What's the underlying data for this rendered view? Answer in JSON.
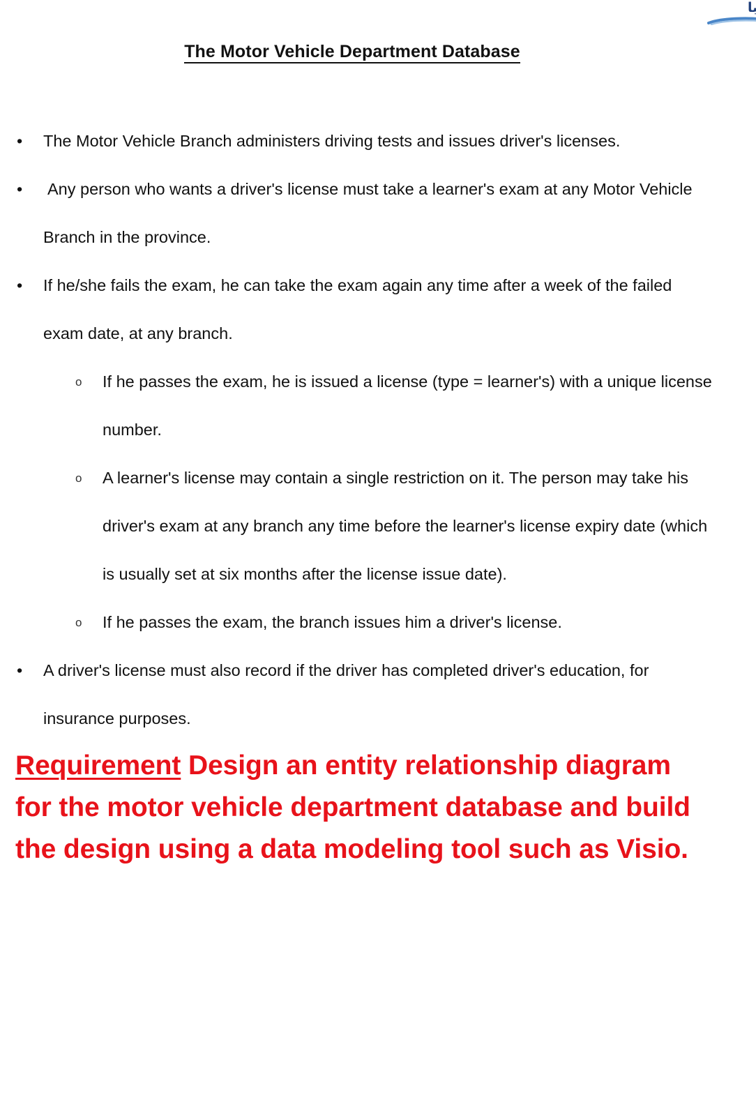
{
  "document": {
    "title": "The Motor Vehicle Department Database",
    "watermark": {
      "text": "يبا",
      "color": "#1f3f7a",
      "icon": "partial-arabic-logo"
    },
    "bullets": [
      {
        "marker": "•",
        "text": "The Motor Vehicle Branch administers driving tests and issues driver's licenses.",
        "children": []
      },
      {
        "marker": "•",
        "text": "Any person who wants a driver's license must take a learner's exam at any Motor Vehicle Branch in the province.",
        "children": []
      },
      {
        "marker": "•",
        "text": "If he/she fails the exam, he can take the exam again any time after a week of the failed exam date, at any branch.",
        "children": [
          {
            "marker": "o",
            "text": "If he passes the exam, he is issued a license (type = learner's) with a unique license number."
          },
          {
            "marker": "o",
            "text": "A learner's license may contain a single restriction on it. The person may take his driver's exam at any branch any time before the learner's license expiry date (which is usually set at six months after the license issue date)."
          },
          {
            "marker": "o",
            "text": "If he passes the exam, the branch issues him a driver's license."
          }
        ]
      },
      {
        "marker": "•",
        "text": "A driver's license must also record if the driver has completed driver's education, for insurance purposes.",
        "children": []
      }
    ],
    "requirement": {
      "label": "Requirement",
      "body": " Design an entity relationship diagram for the motor vehicle department database and build the design using a data modeling tool such as Visio.",
      "color": "#E8121A"
    }
  }
}
